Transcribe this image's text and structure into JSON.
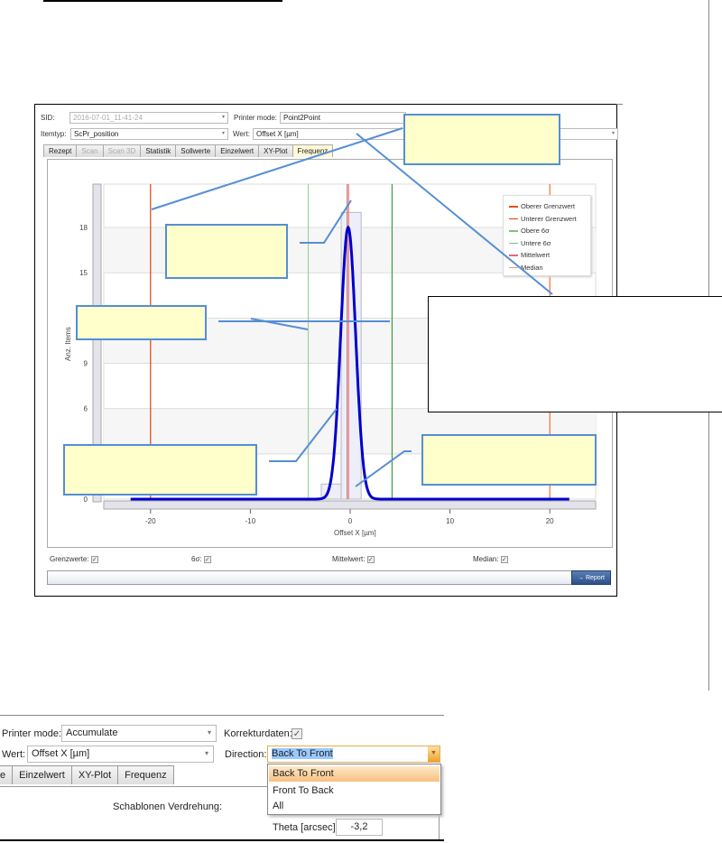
{
  "app1": {
    "sid_label": "SID:",
    "sid_value": "2016-07-01_11-41-24",
    "printer_mode_label": "Printer mode:",
    "printer_mode_value": "Point2Point",
    "itemtyp_label": "Itemtyp:",
    "itemtyp_value": "ScPr_position",
    "wert_label": "Wert:",
    "wert_value": "Offset X [µm]",
    "tabs": [
      {
        "label": "Rezept",
        "state": "normal"
      },
      {
        "label": "Scan",
        "state": "disabled"
      },
      {
        "label": "Scan 3D",
        "state": "disabled"
      },
      {
        "label": "Statistik",
        "state": "normal"
      },
      {
        "label": "Sollwerte",
        "state": "normal"
      },
      {
        "label": "Einzelwert",
        "state": "normal"
      },
      {
        "label": "XY-Plot",
        "state": "normal"
      },
      {
        "label": "Frequenz",
        "state": "active"
      }
    ],
    "checkboxes": [
      {
        "label": "Grenzwerte:",
        "checked": true
      },
      {
        "label": "6σ:",
        "checked": true
      },
      {
        "label": "Mittelwert:",
        "checked": true
      },
      {
        "label": "Median:",
        "checked": true
      }
    ],
    "report_button": "→ Report",
    "check_glyph": "✓"
  },
  "chart_data": {
    "type": "bar",
    "xlabel": "Offset X [µm]",
    "ylabel": "Anz. Items",
    "xlim": [
      -25,
      25
    ],
    "ylim": [
      0,
      19.5
    ],
    "xticks": [
      -20,
      -10,
      0,
      10,
      20
    ],
    "yticks": [
      0,
      3,
      6,
      9,
      12,
      15,
      18
    ],
    "ytick_labels_visible": [
      "0",
      "6",
      "9",
      "15",
      "18"
    ],
    "histogram": [
      {
        "x0": -2.9,
        "x1": -0.9,
        "count": 1
      },
      {
        "x0": -0.9,
        "x1": 1.1,
        "count": 19
      }
    ],
    "gaussian_fit": {
      "mean": -0.2,
      "sigma": 0.75,
      "peak": 18,
      "range": [
        -22,
        22
      ]
    },
    "vertical_lines": [
      {
        "name": "Oberer Grenzwert",
        "x": 20,
        "color": "#f07030"
      },
      {
        "name": "Unterer Grenzwert",
        "x": -20,
        "color": "#e04010"
      },
      {
        "name": "Obere 6σ",
        "x": 4.2,
        "color": "#3aa03a"
      },
      {
        "name": "Untere 6σ",
        "x": -4.2,
        "color": "#9fcf9f"
      },
      {
        "name": "Mittelwert",
        "x": -0.15,
        "color": "#f08090"
      },
      {
        "name": "Median",
        "x": -0.3,
        "color": "#c08070"
      }
    ],
    "legend": [
      "Oberer Grenzwert",
      "Unterer Grenzwert",
      "Obere 6σ",
      "Untere 6σ",
      "Mittelwert",
      "Median"
    ],
    "legend_colors": [
      "#e8500a",
      "#e04010",
      "#80c080",
      "#80c080",
      "#f06080",
      "#e0a070"
    ],
    "legend_position": "top-right",
    "curve_color": "#0000cc"
  },
  "app2": {
    "printer_mode_label": "Printer mode:",
    "printer_mode_value": "Accumulate",
    "korrektur_label": "Korrekturdaten:",
    "wert_label": "Wert:",
    "wert_value": "Offset X [µm]",
    "direction_label": "Direction:",
    "direction_value": "Back To Front",
    "direction_options": [
      "Back To Front",
      "Front To Back",
      "All"
    ],
    "tabs": [
      "e",
      "Einzelwert",
      "XY-Plot",
      "Frequenz"
    ],
    "schablonen_label": "Schablonen Verdrehung:",
    "theta_label": "Theta [arcsec]:",
    "theta_value": "-3,2",
    "check_glyph": "✓"
  }
}
